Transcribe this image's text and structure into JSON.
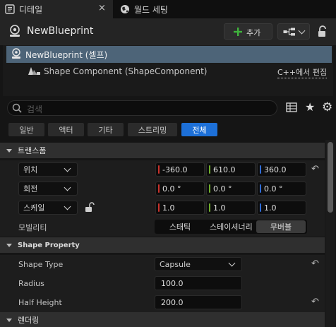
{
  "tabs": [
    {
      "label": "디테일",
      "close": "×"
    },
    {
      "label": "월드 세팅"
    }
  ],
  "header": {
    "title": "NewBlueprint",
    "add_label": "추가"
  },
  "tree": {
    "root_label": "NewBlueprint (셀프)",
    "child_label": "Shape Component (ShapeComponent)",
    "edit_link": "C++에서 편집"
  },
  "search": {
    "placeholder": "검색"
  },
  "filters": [
    "일반",
    "액터",
    "기타",
    "스트리밍",
    "전체"
  ],
  "active_filter": "전체",
  "transform": {
    "section_label": "트랜스폼",
    "location": {
      "label": "위치",
      "x": "-360.0",
      "y": "610.0",
      "z": "360.0"
    },
    "rotation": {
      "label": "회전",
      "x": "0.0 °",
      "y": "0.0 °",
      "z": "0.0 °"
    },
    "scale": {
      "label": "스케일",
      "x": "1.0",
      "y": "1.0",
      "z": "1.0"
    },
    "mobility": {
      "label": "모빌리티",
      "options": [
        "스태틱",
        "스테이셔너리",
        "무버블"
      ],
      "selected": "무버블"
    }
  },
  "shape_property": {
    "section_label": "Shape Property",
    "shape_type": {
      "label": "Shape Type",
      "value": "Capsule"
    },
    "radius": {
      "label": "Radius",
      "value": "100.0"
    },
    "half_height": {
      "label": "Half Height",
      "value": "200.0"
    }
  },
  "rendering": {
    "section_label": "렌더링"
  },
  "colors": {
    "x_axis": "#c8322b",
    "y_axis": "#6fae2c",
    "z_axis": "#2f6bd6",
    "accent": "#1d70d8",
    "selection": "#4d6478"
  }
}
